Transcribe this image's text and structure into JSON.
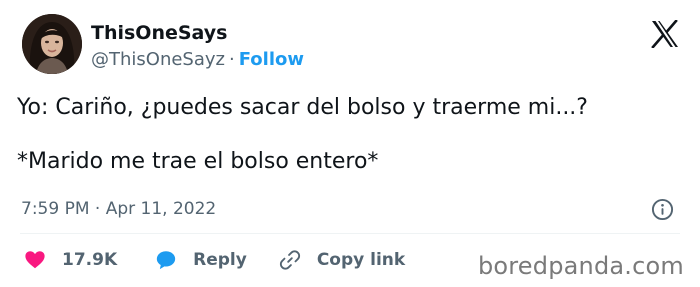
{
  "author": {
    "name": "ThisOneSays",
    "handle": "@ThisOneSayz",
    "separator": "·",
    "follow_label": "Follow"
  },
  "tweet": {
    "text": "Yo: Cariño, ¿puedes sacar del bolso y traerme mi...?\n\n*Marido me trae el bolso entero*",
    "timestamp": "7:59 PM · Apr 11, 2022"
  },
  "actions": {
    "likes_count": "17.9K",
    "reply_label": "Reply",
    "copy_link_label": "Copy link"
  },
  "icons": {
    "logo": "x-logo-icon",
    "info": "info-icon",
    "like": "heart-icon",
    "reply": "speech-bubble-icon",
    "copy": "link-icon"
  },
  "colors": {
    "accent": "#1d9bf0",
    "like": "#f91880",
    "muted": "#536471",
    "text": "#0f1419"
  },
  "watermark": "boredpanda.com"
}
